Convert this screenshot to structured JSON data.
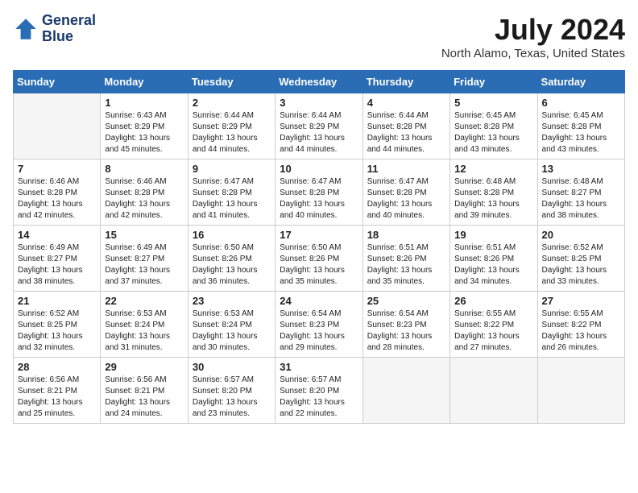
{
  "header": {
    "logo_line1": "General",
    "logo_line2": "Blue",
    "month_year": "July 2024",
    "location": "North Alamo, Texas, United States"
  },
  "weekdays": [
    "Sunday",
    "Monday",
    "Tuesday",
    "Wednesday",
    "Thursday",
    "Friday",
    "Saturday"
  ],
  "weeks": [
    [
      {
        "day": "",
        "empty": true
      },
      {
        "day": "1",
        "sunrise": "6:43 AM",
        "sunset": "8:29 PM",
        "daylight": "13 hours and 45 minutes."
      },
      {
        "day": "2",
        "sunrise": "6:44 AM",
        "sunset": "8:29 PM",
        "daylight": "13 hours and 44 minutes."
      },
      {
        "day": "3",
        "sunrise": "6:44 AM",
        "sunset": "8:29 PM",
        "daylight": "13 hours and 44 minutes."
      },
      {
        "day": "4",
        "sunrise": "6:44 AM",
        "sunset": "8:28 PM",
        "daylight": "13 hours and 44 minutes."
      },
      {
        "day": "5",
        "sunrise": "6:45 AM",
        "sunset": "8:28 PM",
        "daylight": "13 hours and 43 minutes."
      },
      {
        "day": "6",
        "sunrise": "6:45 AM",
        "sunset": "8:28 PM",
        "daylight": "13 hours and 43 minutes."
      }
    ],
    [
      {
        "day": "7",
        "sunrise": "6:46 AM",
        "sunset": "8:28 PM",
        "daylight": "13 hours and 42 minutes."
      },
      {
        "day": "8",
        "sunrise": "6:46 AM",
        "sunset": "8:28 PM",
        "daylight": "13 hours and 42 minutes."
      },
      {
        "day": "9",
        "sunrise": "6:47 AM",
        "sunset": "8:28 PM",
        "daylight": "13 hours and 41 minutes."
      },
      {
        "day": "10",
        "sunrise": "6:47 AM",
        "sunset": "8:28 PM",
        "daylight": "13 hours and 40 minutes."
      },
      {
        "day": "11",
        "sunrise": "6:47 AM",
        "sunset": "8:28 PM",
        "daylight": "13 hours and 40 minutes."
      },
      {
        "day": "12",
        "sunrise": "6:48 AM",
        "sunset": "8:28 PM",
        "daylight": "13 hours and 39 minutes."
      },
      {
        "day": "13",
        "sunrise": "6:48 AM",
        "sunset": "8:27 PM",
        "daylight": "13 hours and 38 minutes."
      }
    ],
    [
      {
        "day": "14",
        "sunrise": "6:49 AM",
        "sunset": "8:27 PM",
        "daylight": "13 hours and 38 minutes."
      },
      {
        "day": "15",
        "sunrise": "6:49 AM",
        "sunset": "8:27 PM",
        "daylight": "13 hours and 37 minutes."
      },
      {
        "day": "16",
        "sunrise": "6:50 AM",
        "sunset": "8:26 PM",
        "daylight": "13 hours and 36 minutes."
      },
      {
        "day": "17",
        "sunrise": "6:50 AM",
        "sunset": "8:26 PM",
        "daylight": "13 hours and 35 minutes."
      },
      {
        "day": "18",
        "sunrise": "6:51 AM",
        "sunset": "8:26 PM",
        "daylight": "13 hours and 35 minutes."
      },
      {
        "day": "19",
        "sunrise": "6:51 AM",
        "sunset": "8:26 PM",
        "daylight": "13 hours and 34 minutes."
      },
      {
        "day": "20",
        "sunrise": "6:52 AM",
        "sunset": "8:25 PM",
        "daylight": "13 hours and 33 minutes."
      }
    ],
    [
      {
        "day": "21",
        "sunrise": "6:52 AM",
        "sunset": "8:25 PM",
        "daylight": "13 hours and 32 minutes."
      },
      {
        "day": "22",
        "sunrise": "6:53 AM",
        "sunset": "8:24 PM",
        "daylight": "13 hours and 31 minutes."
      },
      {
        "day": "23",
        "sunrise": "6:53 AM",
        "sunset": "8:24 PM",
        "daylight": "13 hours and 30 minutes."
      },
      {
        "day": "24",
        "sunrise": "6:54 AM",
        "sunset": "8:23 PM",
        "daylight": "13 hours and 29 minutes."
      },
      {
        "day": "25",
        "sunrise": "6:54 AM",
        "sunset": "8:23 PM",
        "daylight": "13 hours and 28 minutes."
      },
      {
        "day": "26",
        "sunrise": "6:55 AM",
        "sunset": "8:22 PM",
        "daylight": "13 hours and 27 minutes."
      },
      {
        "day": "27",
        "sunrise": "6:55 AM",
        "sunset": "8:22 PM",
        "daylight": "13 hours and 26 minutes."
      }
    ],
    [
      {
        "day": "28",
        "sunrise": "6:56 AM",
        "sunset": "8:21 PM",
        "daylight": "13 hours and 25 minutes."
      },
      {
        "day": "29",
        "sunrise": "6:56 AM",
        "sunset": "8:21 PM",
        "daylight": "13 hours and 24 minutes."
      },
      {
        "day": "30",
        "sunrise": "6:57 AM",
        "sunset": "8:20 PM",
        "daylight": "13 hours and 23 minutes."
      },
      {
        "day": "31",
        "sunrise": "6:57 AM",
        "sunset": "8:20 PM",
        "daylight": "13 hours and 22 minutes."
      },
      {
        "day": "",
        "empty": true
      },
      {
        "day": "",
        "empty": true
      },
      {
        "day": "",
        "empty": true
      }
    ]
  ]
}
